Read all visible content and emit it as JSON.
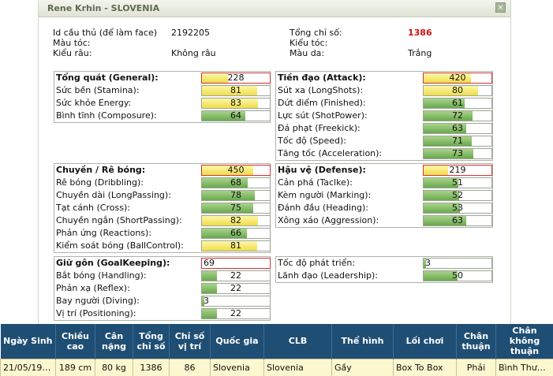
{
  "dialog": {
    "title": "Rene Krhin - SLOVENIA",
    "close_glyph": "×"
  },
  "info": {
    "id_label": "Id cầu thủ (để làm face)",
    "id_value": "2192205",
    "hair_color_label": "Màu tóc:",
    "beard_label": "Kiểu râu:",
    "beard_value": "Không râu",
    "total_label": "Tổng chỉ số:",
    "total_value": "1386",
    "hair_style_label": "Kiểu tóc:",
    "skin_label": "Màu da:",
    "skin_value": "Trắng"
  },
  "general": {
    "header": "Tổng quát (General):",
    "header_value": "228",
    "rows": [
      {
        "label": "Sức bền (Stamina):",
        "value": "81"
      },
      {
        "label": "Sức khỏe Energy:",
        "value": "83"
      },
      {
        "label": "Bình tĩnh (Composure):",
        "value": "64"
      }
    ]
  },
  "attack": {
    "header": "Tiền đạo (Attack):",
    "header_value": "420",
    "rows": [
      {
        "label": "Sút xa (LongShots):",
        "value": "80"
      },
      {
        "label": "Dứt điểm (Finished):",
        "value": "61"
      },
      {
        "label": "Lực sút (ShotPower):",
        "value": "72"
      },
      {
        "label": "Đá phạt (Freekick):",
        "value": "63"
      },
      {
        "label": "Tốc độ (Speed):",
        "value": "71"
      },
      {
        "label": "Tăng tốc (Acceleration):",
        "value": "73"
      }
    ]
  },
  "dribbling": {
    "header": "Chuyền / Rê bóng:",
    "header_value": "450",
    "rows": [
      {
        "label": "Rê bóng (Dribbling):",
        "value": "68"
      },
      {
        "label": "Chuyền dài (LongPassing):",
        "value": "78"
      },
      {
        "label": "Tạt cánh (Cross):",
        "value": "75"
      },
      {
        "label": "Chuyền ngắn (ShortPassing):",
        "value": "82"
      },
      {
        "label": "Phản ứng (Reactions):",
        "value": "66"
      },
      {
        "label": "Kiểm soát bóng (BallControl):",
        "value": "81"
      }
    ]
  },
  "defense": {
    "header": "Hậu vệ (Defense):",
    "header_value": "219",
    "rows": [
      {
        "label": "Cản phá (Taclke):",
        "value": "51"
      },
      {
        "label": "Kèm người (Marking):",
        "value": "52"
      },
      {
        "label": "Đánh đầu (Heading):",
        "value": "53"
      },
      {
        "label": "Xông xáo (Aggression):",
        "value": "63"
      }
    ]
  },
  "goalkeeping": {
    "header": "Giữ gôn (GoalKeeping):",
    "header_value": "69",
    "rows": [
      {
        "label": "Bắt bóng (Handling):",
        "value": "22"
      },
      {
        "label": "Phản xạ (Reflex):",
        "value": "22"
      },
      {
        "label": "Bay người (Diving):",
        "value": "3"
      },
      {
        "label": "Vị trí (Positioning):",
        "value": "22"
      }
    ]
  },
  "growth": {
    "rows": [
      {
        "label": "Tốc độ phát triển:",
        "value": "3"
      },
      {
        "label": "Lãnh đạo (Leadership):",
        "value": "50"
      }
    ]
  },
  "table": {
    "headers": [
      "Ngày Sinh",
      "Chiều cao",
      "Cân nặng",
      "Tổng chỉ số",
      "Chỉ số vị trí",
      "Quốc gia",
      "CLB",
      "Thể hình",
      "Lối chơi",
      "Chân thuận",
      "Chân không thuận"
    ],
    "row": [
      "21/05/1990",
      "189 cm",
      "80 kg",
      "1386",
      "86",
      "Slovenia",
      "Slovenia",
      "Gầy",
      "Box To Box",
      "Phải",
      "Bình Thường"
    ]
  }
}
